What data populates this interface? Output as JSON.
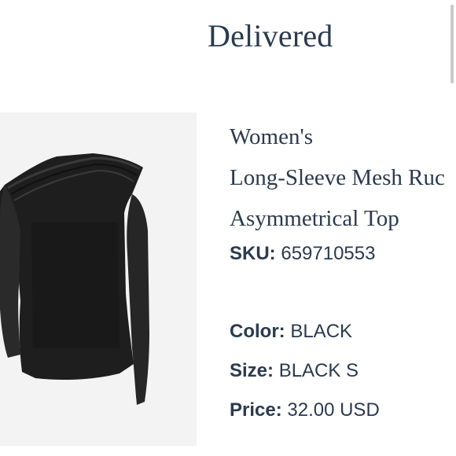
{
  "status": {
    "title": "Delivered"
  },
  "product": {
    "name_lines": [
      "Women's",
      "Long-Sleeve Mesh Ruc",
      "Asymmetrical Top"
    ],
    "sku_label": "SKU:",
    "sku_value": "659710553",
    "color_label": "Color:",
    "color_value": "BLACK",
    "size_label": "Size:",
    "size_value": "BLACK S",
    "price_label": "Price:",
    "price_value": "32.00 USD",
    "image_icon": "black-asymmetrical-mesh-top-photo"
  },
  "colors": {
    "text": "#2b3a4f",
    "image_bg": "#f3f3f3",
    "garment": "#1f1f1f"
  }
}
